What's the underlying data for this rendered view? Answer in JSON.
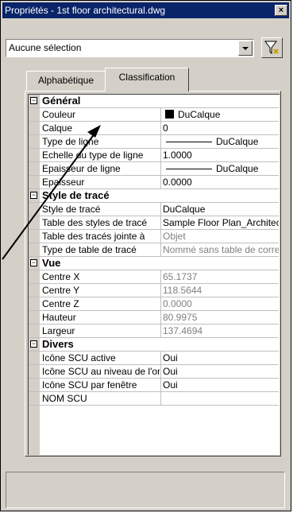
{
  "window": {
    "title": "Propriétés - 1st floor architectural.dwg",
    "close_glyph": "×"
  },
  "selection": {
    "value": "Aucune sélection"
  },
  "tabs": [
    {
      "label": "Alphabétique"
    },
    {
      "label": "Classification"
    }
  ],
  "categories": [
    {
      "name": "Général",
      "rows": [
        {
          "key": "Couleur",
          "value": "DuCalque",
          "decor": "swatch",
          "gray": false
        },
        {
          "key": "Calque",
          "value": "0",
          "gray": false
        },
        {
          "key": "Type de ligne",
          "value": "DuCalque",
          "decor": "line",
          "gray": false
        },
        {
          "key": "Echelle du type de ligne",
          "value": "1.0000",
          "gray": false
        },
        {
          "key": "Epaisseur de ligne",
          "value": "DuCalque",
          "decor": "line",
          "gray": false
        },
        {
          "key": "Epaisseur",
          "value": "0.0000",
          "gray": false
        }
      ]
    },
    {
      "name": "Style de tracé",
      "rows": [
        {
          "key": "Style de tracé",
          "value": "DuCalque",
          "gray": false
        },
        {
          "key": "Table des styles de tracé",
          "value": "Sample Floor Plan_Architecture",
          "gray": false
        },
        {
          "key": "Table des tracés jointe à",
          "value": "Objet",
          "gray": true
        },
        {
          "key": "Type de table de tracé",
          "value": "Nommé sans table de correspondance",
          "gray": true
        }
      ]
    },
    {
      "name": "Vue",
      "rows": [
        {
          "key": "Centre X",
          "value": "65.1737",
          "gray": true
        },
        {
          "key": "Centre Y",
          "value": "118.5644",
          "gray": true
        },
        {
          "key": "Centre Z",
          "value": "0.0000",
          "gray": true
        },
        {
          "key": "Hauteur",
          "value": "80.9975",
          "gray": true
        },
        {
          "key": "Largeur",
          "value": "137.4694",
          "gray": true
        }
      ]
    },
    {
      "name": "Divers",
      "rows": [
        {
          "key": "Icône SCU active",
          "value": "Oui",
          "gray": false
        },
        {
          "key": "Icône SCU au niveau de l'origine",
          "value": "Oui",
          "gray": false
        },
        {
          "key": "Icône SCU par fenêtre",
          "value": "Oui",
          "gray": false
        },
        {
          "key": "NOM SCU",
          "value": "",
          "gray": false
        }
      ]
    }
  ],
  "icons": {
    "expander": "minus-box-icon",
    "filter": "quick-select-filter-icon",
    "dropdown": "chevron-down-icon"
  }
}
